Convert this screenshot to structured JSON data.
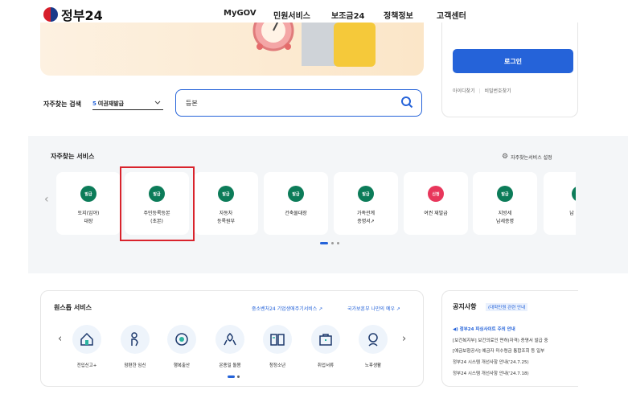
{
  "header": {
    "logo_text": "정부24",
    "nav": [
      "MyGOV",
      "민원서비스",
      "보조금24",
      "정책정보",
      "고객센터"
    ]
  },
  "login": {
    "button_label": "로그인",
    "find_id": "아이디찾기",
    "find_pw": "비밀번호찾기"
  },
  "search": {
    "label": "자주찾는 검색",
    "select_num": "5",
    "select_value": "여권재발급",
    "input_value": "등본"
  },
  "frequent": {
    "title": "자주찾는 서비스",
    "setting_label": "자주찾는서비스 설정",
    "cards": [
      {
        "badge": "발급",
        "label": "토지(임야)\n대장"
      },
      {
        "badge": "발급",
        "label": "주민등록등본\n(초본)"
      },
      {
        "badge": "발급",
        "label": "자동차\n등록원부"
      },
      {
        "badge": "발급",
        "label": "건축물대장"
      },
      {
        "badge": "발급",
        "label": "가족관계\n증명서"
      },
      {
        "badge": "신청",
        "label": "여권 재발급"
      },
      {
        "badge": "발급",
        "label": "지방세\n납세증명"
      },
      {
        "badge": "발급",
        "label": "납"
      }
    ]
  },
  "onestop": {
    "title": "원스톱 서비스",
    "link1": "중소벤처24 기업생애주기서비스",
    "link2": "국가보훈부 나만의 예우",
    "items": [
      "전입신고+",
      "맘편한 임신",
      "행복출산",
      "온종일 돌봄",
      "청정소년",
      "취업서류",
      "노후생활"
    ]
  },
  "notice": {
    "title": "공지사항",
    "tag": "(대학민원 관련 안내",
    "items": [
      "정부24 피싱사이트 주의 안내",
      "[보건복지부] 보건의료인 면허(자격) 증명서 발급 중",
      "[예금보험공사] 예금자 미수령금 통합조회 등 일부",
      "정부24 시스템 개선사항 안내('24.7.25)",
      "정부24 시스템 개선사항 안내('24.7.18)"
    ]
  }
}
